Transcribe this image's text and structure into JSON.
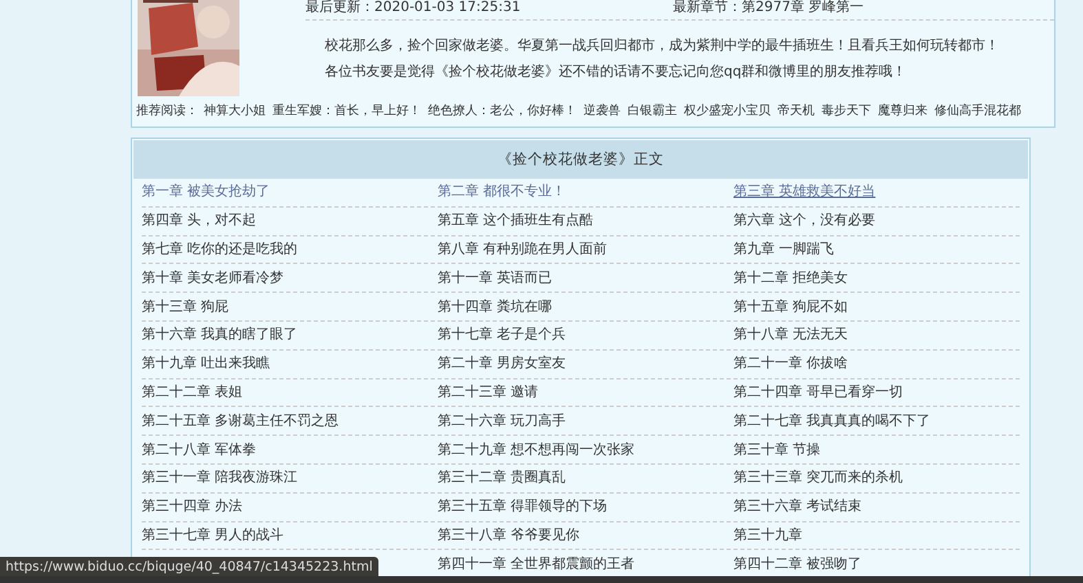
{
  "book": {
    "last_updated_label": "最后更新：",
    "last_updated": "2020-01-03 17:25:31",
    "latest_label": "最新章节：",
    "latest_chapter": "第2977章 罗峰第一",
    "description": [
      "校花那么多，捡个回家做老婆。华夏第一战兵回归都市，成为紫荆中学的最牛插班生！且看兵王如何玩转都市！",
      "各位书友要是觉得《捡个校花做老婆》还不错的话请不要忘记向您qq群和微博里的朋友推荐哦！"
    ]
  },
  "recommend": {
    "label": "推荐阅读：",
    "links": [
      "神算大小姐",
      "重生军嫂：首长，早上好！",
      "绝色撩人：老公，你好棒！",
      "逆袭兽",
      "白银霸主",
      "权少盛宠小宝贝",
      "帝天机",
      "毒步天下",
      "魔尊归来",
      "修仙高手混花都"
    ]
  },
  "chapter_list": {
    "title": "《捡个校花做老婆》正文",
    "rows": [
      [
        {
          "title": "第一章 被美女抢劫了",
          "visited": true,
          "hovered": false
        },
        {
          "title": "第二章 都很不专业！",
          "visited": true,
          "hovered": false
        },
        {
          "title": "第三章 英雄救美不好当",
          "visited": true,
          "hovered": true
        }
      ],
      [
        {
          "title": "第四章 头，对不起",
          "visited": false,
          "hovered": false
        },
        {
          "title": "第五章 这个插班生有点酷",
          "visited": false,
          "hovered": false
        },
        {
          "title": "第六章 这个，没有必要",
          "visited": false,
          "hovered": false
        }
      ],
      [
        {
          "title": "第七章 吃你的还是吃我的",
          "visited": false,
          "hovered": false
        },
        {
          "title": "第八章 有种别跪在男人面前",
          "visited": false,
          "hovered": false
        },
        {
          "title": "第九章 一脚踹飞",
          "visited": false,
          "hovered": false
        }
      ],
      [
        {
          "title": "第十章 美女老师看冷梦",
          "visited": false,
          "hovered": false
        },
        {
          "title": "第十一章 英语而已",
          "visited": false,
          "hovered": false
        },
        {
          "title": "第十二章 拒绝美女",
          "visited": false,
          "hovered": false
        }
      ],
      [
        {
          "title": "第十三章 狗屁",
          "visited": false,
          "hovered": false
        },
        {
          "title": "第十四章 粪坑在哪",
          "visited": false,
          "hovered": false
        },
        {
          "title": "第十五章 狗屁不如",
          "visited": false,
          "hovered": false
        }
      ],
      [
        {
          "title": "第十六章 我真的瞎了眼了",
          "visited": false,
          "hovered": false
        },
        {
          "title": "第十七章 老子是个兵",
          "visited": false,
          "hovered": false
        },
        {
          "title": "第十八章 无法无天",
          "visited": false,
          "hovered": false
        }
      ],
      [
        {
          "title": "第十九章 吐出来我瞧",
          "visited": false,
          "hovered": false
        },
        {
          "title": "第二十章 男房女室友",
          "visited": false,
          "hovered": false
        },
        {
          "title": "第二十一章 你拔啥",
          "visited": false,
          "hovered": false
        }
      ],
      [
        {
          "title": "第二十二章 表姐",
          "visited": false,
          "hovered": false
        },
        {
          "title": "第二十三章 邀请",
          "visited": false,
          "hovered": false
        },
        {
          "title": "第二十四章 哥早已看穿一切",
          "visited": false,
          "hovered": false
        }
      ],
      [
        {
          "title": "第二十五章 多谢葛主任不罚之恩",
          "visited": false,
          "hovered": false
        },
        {
          "title": "第二十六章 玩刀高手",
          "visited": false,
          "hovered": false
        },
        {
          "title": "第二十七章 我真真真的喝不下了",
          "visited": false,
          "hovered": false
        }
      ],
      [
        {
          "title": "第二十八章 军体拳",
          "visited": false,
          "hovered": false
        },
        {
          "title": "第二十九章 想不想再闯一次张家",
          "visited": false,
          "hovered": false
        },
        {
          "title": "第三十章 节操",
          "visited": false,
          "hovered": false
        }
      ],
      [
        {
          "title": "第三十一章 陪我夜游珠江",
          "visited": false,
          "hovered": false
        },
        {
          "title": "第三十二章 贵圈真乱",
          "visited": false,
          "hovered": false
        },
        {
          "title": "第三十三章 突兀而来的杀机",
          "visited": false,
          "hovered": false
        }
      ],
      [
        {
          "title": "第三十四章 办法",
          "visited": false,
          "hovered": false
        },
        {
          "title": "第三十五章 得罪领导的下场",
          "visited": false,
          "hovered": false
        },
        {
          "title": "第三十六章 考试结束",
          "visited": false,
          "hovered": false
        }
      ],
      [
        {
          "title": "第三十七章 男人的战斗",
          "visited": false,
          "hovered": false
        },
        {
          "title": "第三十八章 爷爷要见你",
          "visited": false,
          "hovered": false
        },
        {
          "title": "第三十九章",
          "visited": false,
          "hovered": false
        }
      ],
      [
        null,
        {
          "title": "第四十一章 全世界都震颤的王者",
          "visited": false,
          "hovered": false
        },
        {
          "title": "第四十二章 被强吻了",
          "visited": false,
          "hovered": false
        }
      ]
    ]
  },
  "status_url": "https://www.biduo.cc/biquge/40_40847/c14345223.html"
}
